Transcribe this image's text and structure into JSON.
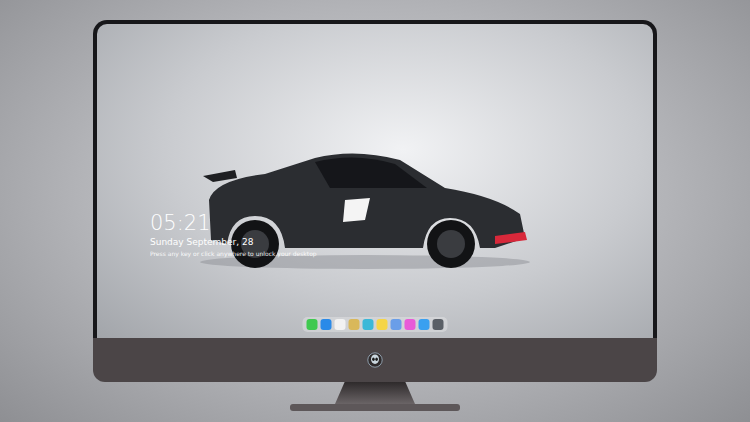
{
  "lock_screen": {
    "time": "05:21",
    "date": "Sunday September, 28",
    "message": "Press any key or click anywhere to unlock your desktop"
  },
  "dock": {
    "apps": [
      {
        "color": "#3fc94f"
      },
      {
        "color": "#2a8ae8"
      },
      {
        "color": "#f2f2f2"
      },
      {
        "color": "#d9b85a"
      },
      {
        "color": "#3bb8d8"
      },
      {
        "color": "#f5d547"
      },
      {
        "color": "#6a9ee8"
      },
      {
        "color": "#e85bd8"
      },
      {
        "color": "#3aa0f0"
      },
      {
        "color": "#5a5f66"
      }
    ]
  }
}
